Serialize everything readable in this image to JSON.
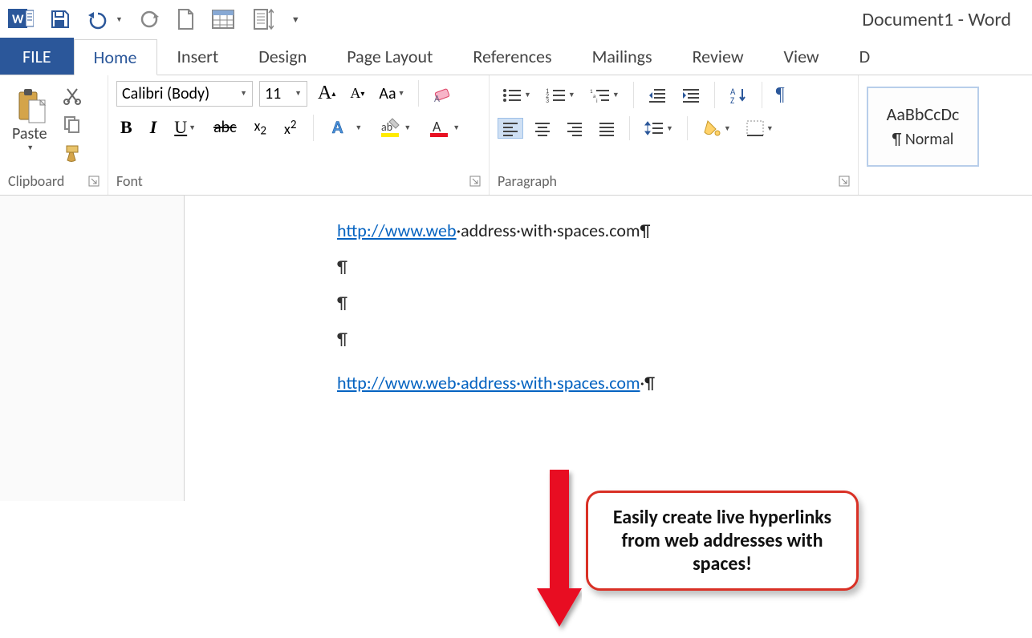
{
  "app": {
    "title": "Document1 - Word"
  },
  "tabs": {
    "file": "FILE",
    "list": [
      "Home",
      "Insert",
      "Design",
      "Page Layout",
      "References",
      "Mailings",
      "Review",
      "View",
      "D"
    ],
    "active_index": 0
  },
  "clipboard": {
    "paste": "Paste",
    "label": "Clipboard"
  },
  "font": {
    "name": "Calibri (Body)",
    "size": "11",
    "aa": "Aa",
    "label": "Font",
    "bold": "B",
    "italic": "I",
    "underline": "U",
    "strike": "abc",
    "sub": "x",
    "sub2": "2",
    "sup": "x",
    "sup2": "2",
    "grow": "A",
    "shrink": "A"
  },
  "paragraph": {
    "label": "Paragraph"
  },
  "styles": {
    "sample": "AaBbCcDc",
    "name": "¶ Normal"
  },
  "doc": {
    "line1_link": "http://www.web",
    "line1_rest": "·address·with·spaces.com¶",
    "p": "¶",
    "line5_link": "http://www.web·address·with·spaces.com",
    "line5_rest": "·¶",
    "callout": "Easily create live hyperlinks from web addresses with spaces!"
  }
}
